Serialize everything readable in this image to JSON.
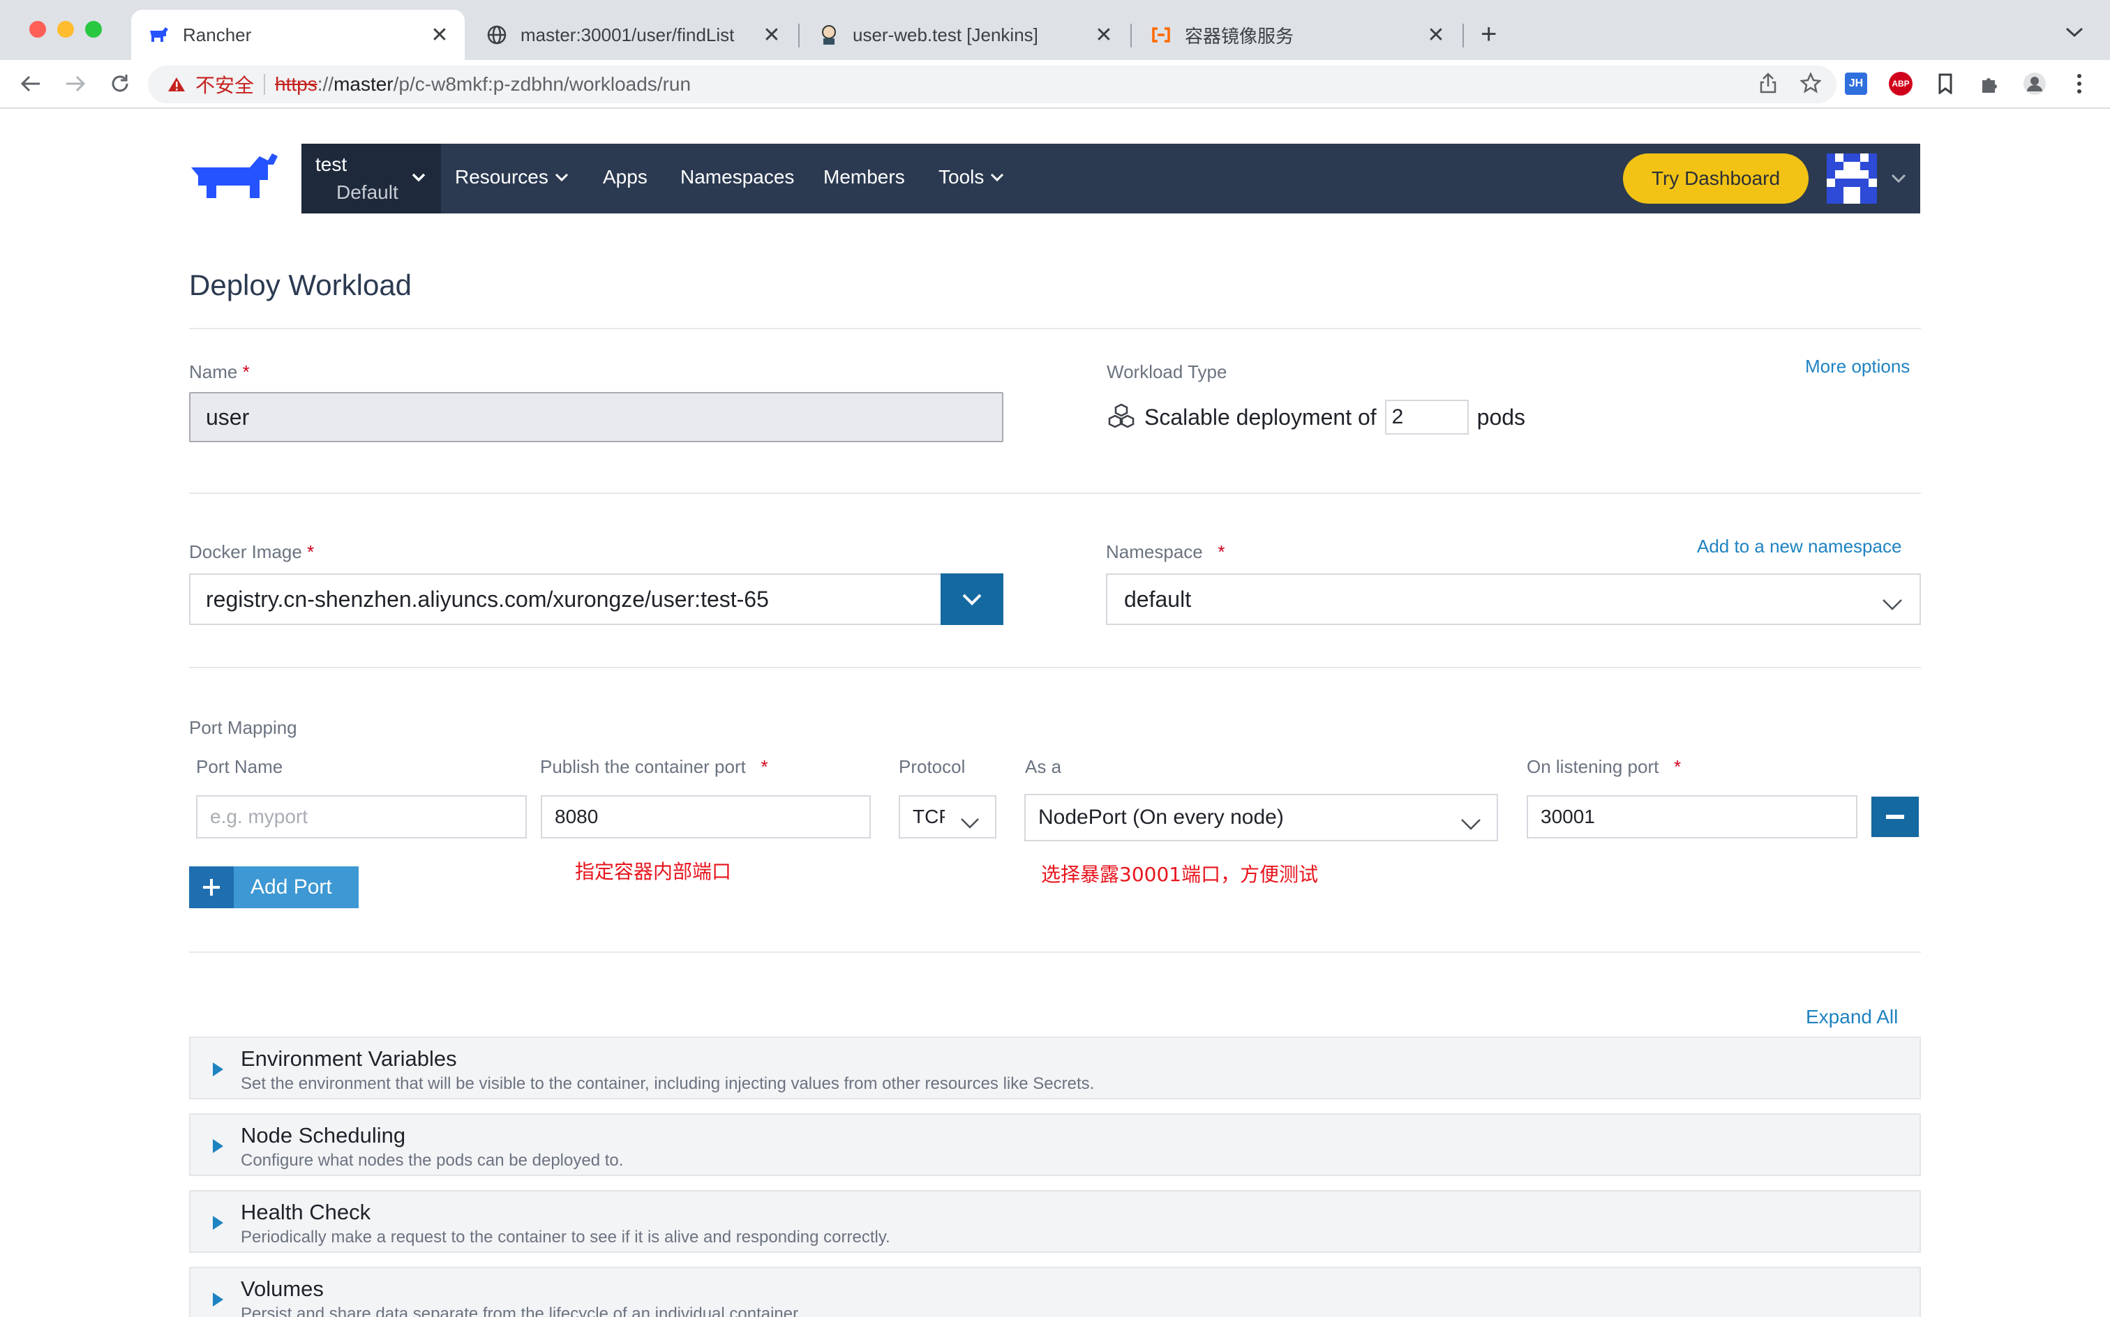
{
  "browser": {
    "tabs": [
      {
        "title": "Rancher",
        "active": true,
        "icon": "rancher-favicon"
      },
      {
        "title": "master:30001/user/findList",
        "active": false,
        "icon": "globe-icon"
      },
      {
        "title": "user-web.test [Jenkins]",
        "active": false,
        "icon": "jenkins-favicon"
      },
      {
        "title": "容器镜像服务",
        "active": false,
        "icon": "aliyun-favicon"
      }
    ],
    "address": {
      "insecure_label": "不安全",
      "scheme": "https",
      "separator": "://",
      "host": "master",
      "path": "/p/c-w8mkf:p-zdbhn/workloads/run"
    },
    "extensions": [
      "JH",
      "ABP"
    ]
  },
  "header": {
    "project_name": "test",
    "project_sub": "Default",
    "nav": [
      "Resources",
      "Apps",
      "Namespaces",
      "Members",
      "Tools"
    ],
    "try_dashboard": "Try Dashboard"
  },
  "form": {
    "title": "Deploy Workload",
    "name": {
      "label": "Name",
      "required": "*",
      "value": "user"
    },
    "workload_type": {
      "label": "Workload Type",
      "more_options": "More options",
      "prefix": "Scalable deployment of",
      "pods_value": "2",
      "suffix": "pods"
    },
    "docker_image": {
      "label": "Docker Image",
      "required": "*",
      "value": "registry.cn-shenzhen.aliyuncs.com/xurongze/user:test-65"
    },
    "namespace": {
      "label": "Namespace",
      "required": "*",
      "add_link": "Add to a new namespace",
      "value": "default"
    },
    "port_mapping": {
      "label": "Port Mapping",
      "columns": {
        "port_name": "Port Name",
        "publish": "Publish the container port",
        "protocol": "Protocol",
        "as_a": "As a",
        "listening": "On listening port",
        "required": "*"
      },
      "row": {
        "port_name_placeholder": "e.g. myport",
        "publish_value": "8080",
        "protocol_value": "TCP",
        "as_a_value": "NodePort (On every node)",
        "listening_value": "30001"
      },
      "add_port": "Add Port",
      "annotation_left": "指定容器内部端口",
      "annotation_right": "选择暴露30001端口，方便测试"
    },
    "expand_all": "Expand All",
    "sections": [
      {
        "title": "Environment Variables",
        "desc": "Set the environment that will be visible to the container, including injecting values from other resources like Secrets."
      },
      {
        "title": "Node Scheduling",
        "desc": "Configure what nodes the pods can be deployed to."
      },
      {
        "title": "Health Check",
        "desc": "Periodically make a request to the container to see if it is alive and responding correctly."
      },
      {
        "title": "Volumes",
        "desc": "Persist and share data separate from the lifecycle of an individual container."
      }
    ]
  },
  "colors": {
    "nav_bg": "#2b3a51",
    "accent": "#1569a1",
    "try_dashboard": "#f2c315",
    "annotation": "#e8141d"
  }
}
